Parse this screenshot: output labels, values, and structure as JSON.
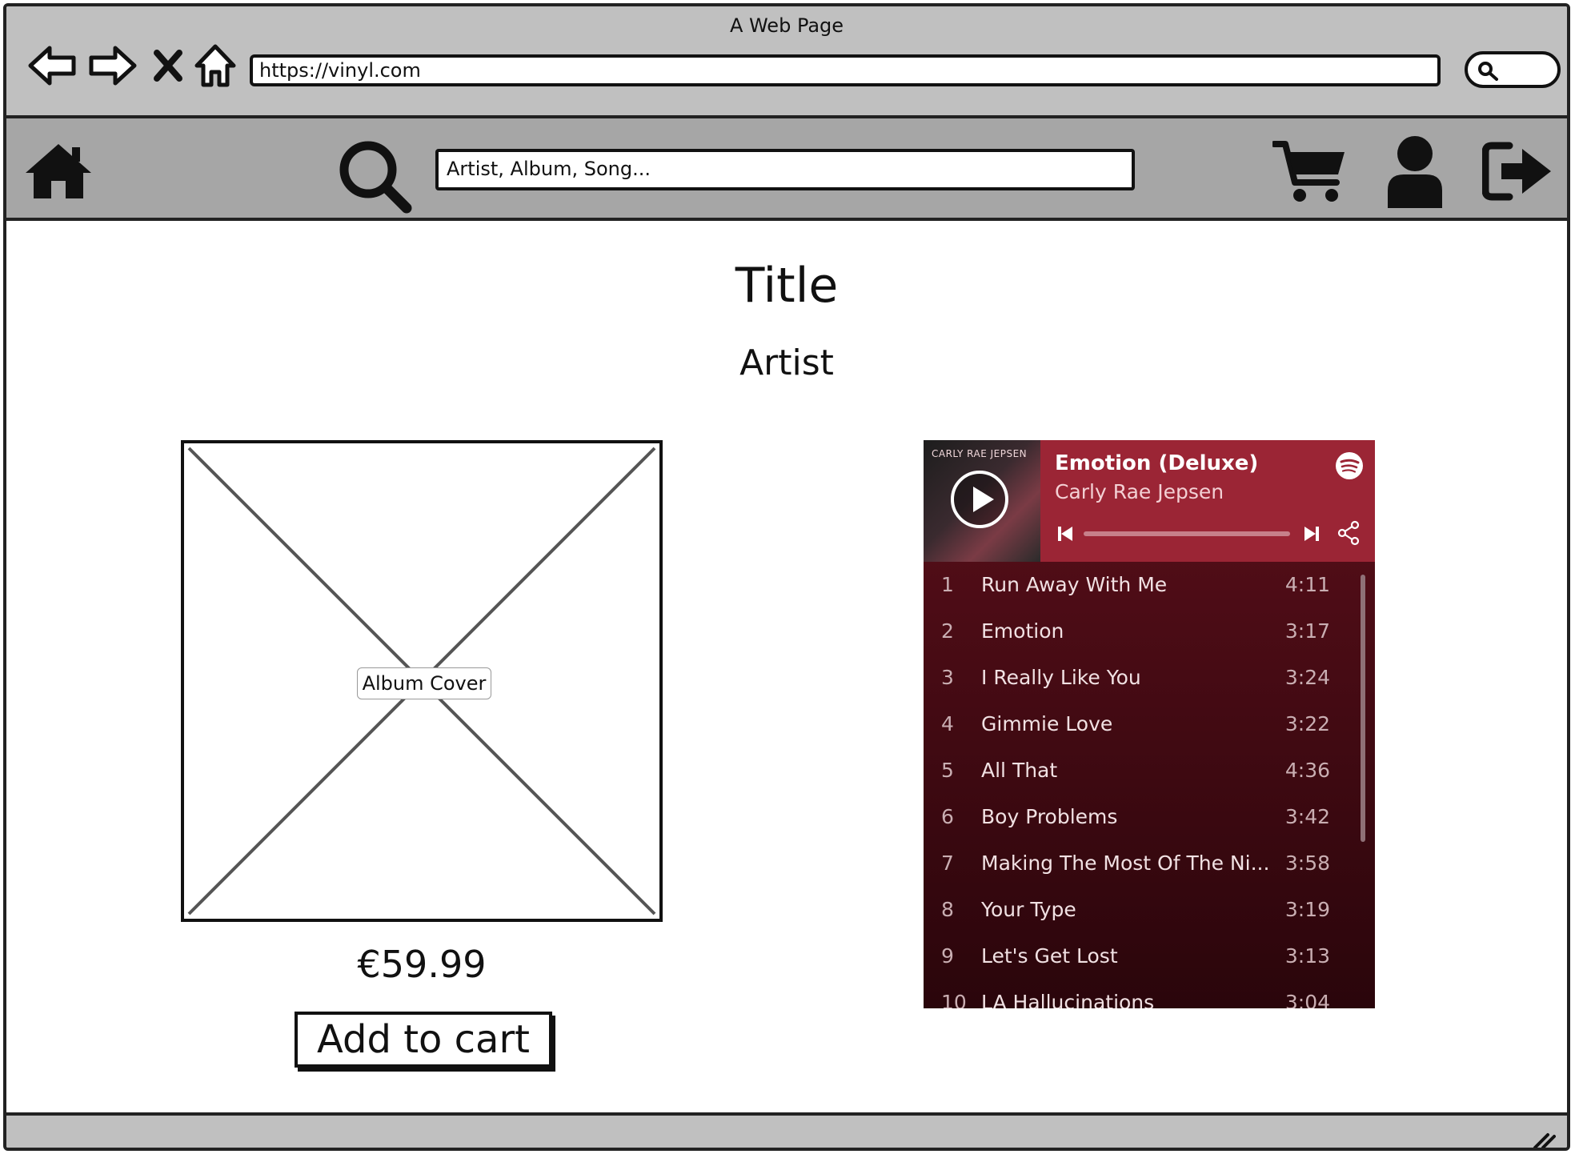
{
  "browser": {
    "title": "A Web Page",
    "url": "https://vinyl.com"
  },
  "nav": {
    "search_placeholder": "Artist, Album, Song..."
  },
  "product": {
    "title": "Title",
    "artist": "Artist",
    "cover_label": "Album Cover",
    "price": "€59.99",
    "add_to_cart": "Add to cart"
  },
  "player": {
    "art_text": "CARLY RAE JEPSEN",
    "album": "Emotion (Deluxe)",
    "artist": "Carly Rae Jepsen",
    "progress": 0,
    "tracks": [
      {
        "num": "1",
        "name": "Run Away With Me",
        "duration": "4:11"
      },
      {
        "num": "2",
        "name": "Emotion",
        "duration": "3:17"
      },
      {
        "num": "3",
        "name": "I Really Like You",
        "duration": "3:24"
      },
      {
        "num": "4",
        "name": "Gimmie Love",
        "duration": "3:22"
      },
      {
        "num": "5",
        "name": "All That",
        "duration": "4:36"
      },
      {
        "num": "6",
        "name": "Boy Problems",
        "duration": "3:42"
      },
      {
        "num": "7",
        "name": "Making The Most Of The Ni...",
        "duration": "3:58"
      },
      {
        "num": "8",
        "name": "Your Type",
        "duration": "3:19"
      },
      {
        "num": "9",
        "name": "Let's Get Lost",
        "duration": "3:13"
      },
      {
        "num": "10",
        "name": "LA Hallucinations",
        "duration": "3:04"
      }
    ],
    "colors": {
      "header": "#9b2535",
      "body": "#5a0f1a"
    }
  }
}
